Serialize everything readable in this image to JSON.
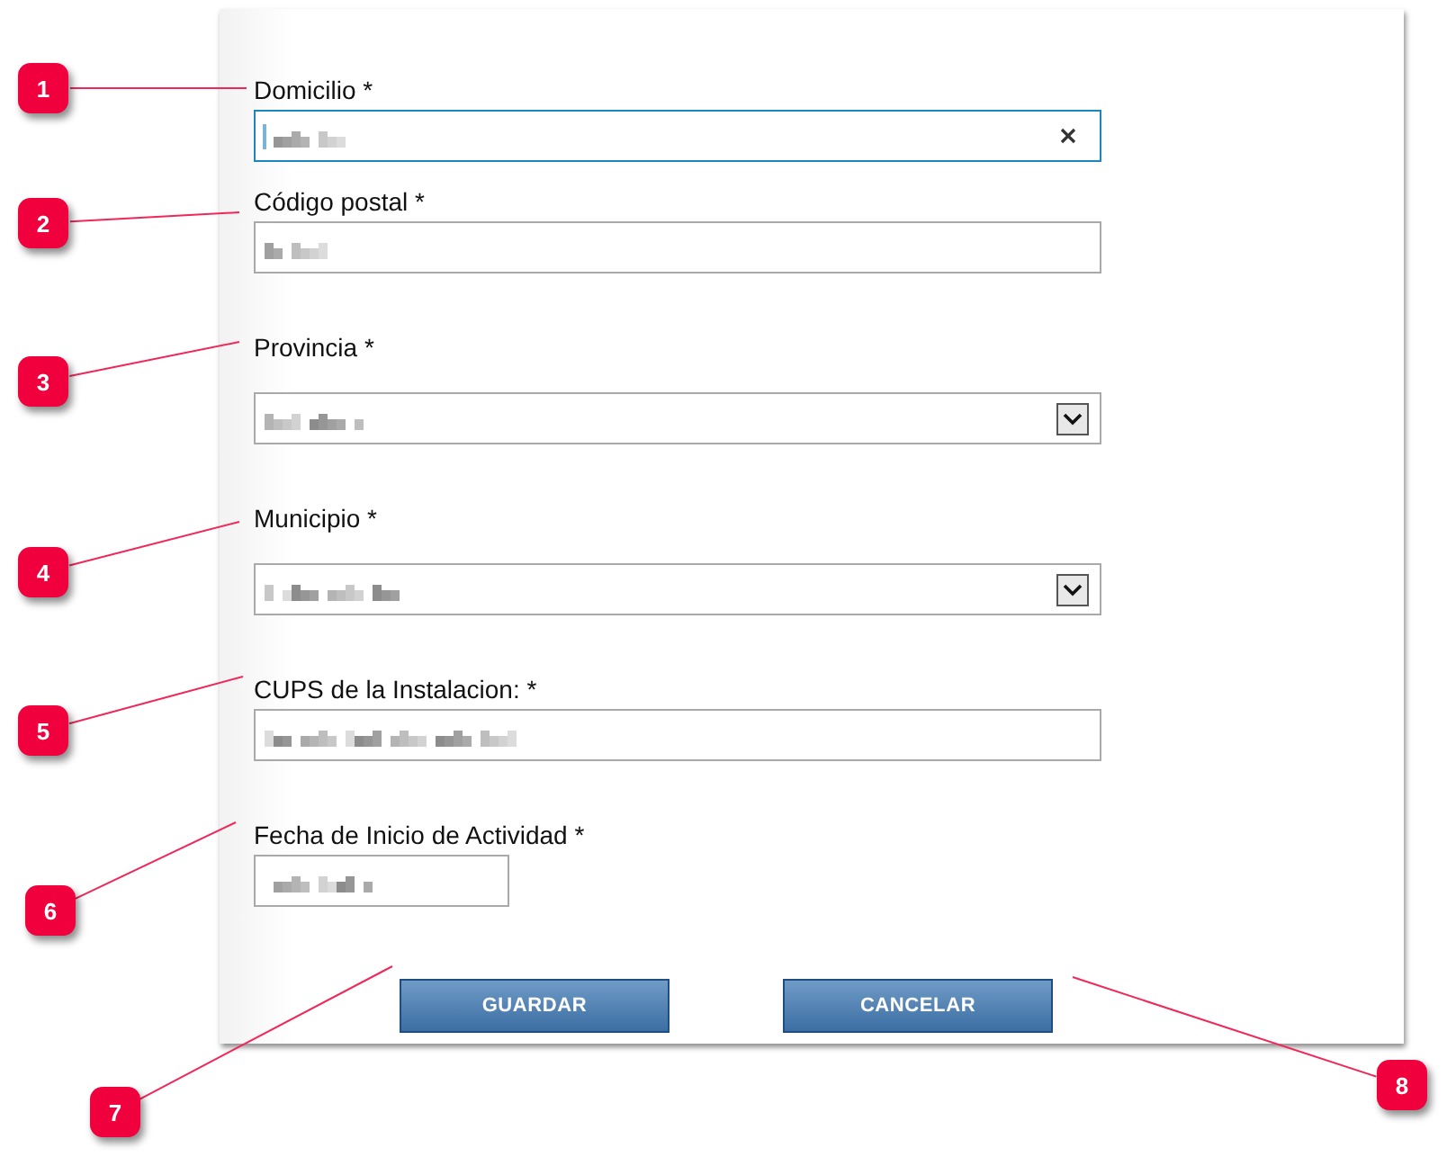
{
  "form": {
    "fields": [
      {
        "label": "Domicilio *",
        "kind": "text",
        "focused": true,
        "clearable": true,
        "blurred": true
      },
      {
        "label": "Código postal *",
        "kind": "text",
        "focused": false,
        "clearable": false,
        "blurred": true
      },
      {
        "label": "Provincia *",
        "kind": "select",
        "focused": false,
        "clearable": false,
        "blurred": true
      },
      {
        "label": "Municipio *",
        "kind": "select",
        "focused": false,
        "clearable": false,
        "blurred": true
      },
      {
        "label": "CUPS de la Instalacion: *",
        "kind": "text",
        "focused": false,
        "clearable": false,
        "blurred": true
      },
      {
        "label": "Fecha de Inicio de Actividad *",
        "kind": "date",
        "focused": false,
        "clearable": false,
        "blurred": true
      }
    ],
    "buttons": [
      "GUARDAR",
      "CANCELAR"
    ]
  },
  "callouts": [
    "1",
    "2",
    "3",
    "4",
    "5",
    "6",
    "7",
    "8"
  ]
}
